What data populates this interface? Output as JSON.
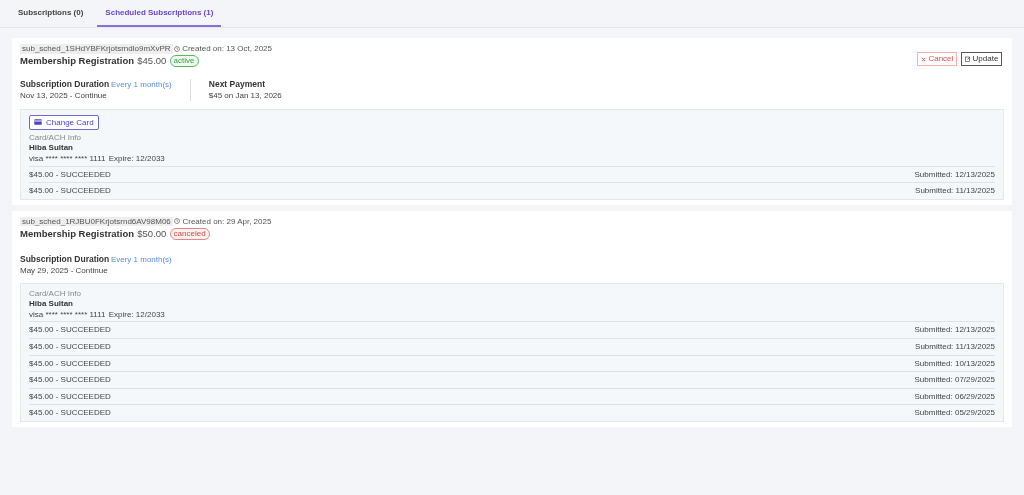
{
  "tabs": [
    {
      "label": "Subscriptions (0)",
      "selected": false
    },
    {
      "label": "Scheduled Subscriptions (1)",
      "selected": true
    }
  ],
  "subscriptions": [
    {
      "id": "sub_sched_1SHdYBFKrjotsrndlo9mXvPR",
      "created": "Created on: 13 Oct, 2025",
      "title": "Membership Registration",
      "price": "$45.00",
      "status": {
        "label": "active",
        "kind": "active"
      },
      "actions": [
        {
          "label": "Cancel",
          "kind": "cancel"
        },
        {
          "label": "Update",
          "kind": "update"
        }
      ],
      "duration": {
        "label": "Subscription Duration",
        "note": "Every 1 month(s)",
        "value": "Nov 13, 2025 - Continue"
      },
      "next_payment": {
        "label": "Next Payment",
        "value": "$45 on Jan 13, 2026"
      },
      "change_card": "Change Card",
      "card": {
        "caption": "Card/ACH Info",
        "holder": "Hiba Sultan",
        "number": "visa **** **** **** 1111",
        "expire": "Expire: 12/2033"
      },
      "payments": [
        {
          "status": "$45.00 - SUCCEEDED",
          "submitted": "Submitted: 12/13/2025"
        },
        {
          "status": "$45.00 - SUCCEEDED",
          "submitted": "Submitted: 11/13/2025"
        }
      ]
    },
    {
      "id": "sub_sched_1RJBU0FKrjotsrnd6AV98M06",
      "created": "Created on: 29 Apr, 2025",
      "title": "Membership Registration",
      "price": "$50.00",
      "status": {
        "label": "canceled",
        "kind": "canceled"
      },
      "duration": {
        "label": "Subscription Duration",
        "note": "Every 1 month(s)",
        "value": "May 29, 2025 - Continue"
      },
      "card": {
        "caption": "Card/ACH Info",
        "holder": "Hiba Sultan",
        "number": "visa **** **** **** 1111",
        "expire": "Expire: 12/2033"
      },
      "payments": [
        {
          "status": "$45.00 - SUCCEEDED",
          "submitted": "Submitted: 12/13/2025"
        },
        {
          "status": "$45.00 - SUCCEEDED",
          "submitted": "Submitted: 11/13/2025"
        },
        {
          "status": "$45.00 - SUCCEEDED",
          "submitted": "Submitted: 10/13/2025"
        },
        {
          "status": "$45.00 - SUCCEEDED",
          "submitted": "Submitted: 07/29/2025"
        },
        {
          "status": "$45.00 - SUCCEEDED",
          "submitted": "Submitted: 06/29/2025"
        },
        {
          "status": "$45.00 - SUCCEEDED",
          "submitted": "Submitted: 05/29/2025"
        }
      ]
    }
  ]
}
